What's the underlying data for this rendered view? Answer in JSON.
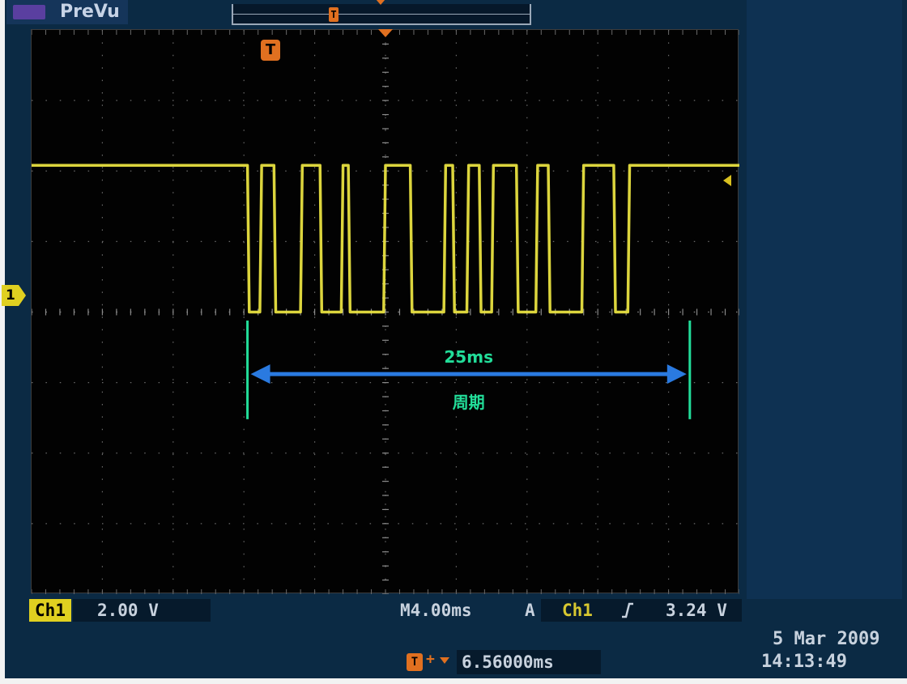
{
  "mode": {
    "label": "PreVu"
  },
  "record": {
    "trigger_marker": "T"
  },
  "annotation": {
    "period_value": "25ms",
    "period_label": "周期",
    "color": "#22dd99"
  },
  "channel": {
    "marker": "1",
    "badge": "Ch1",
    "volts_per_div": "2.00 V",
    "color": "#e8e040"
  },
  "timebase": {
    "value": "M4.00ms"
  },
  "trigger": {
    "mode": "A",
    "source": "Ch1",
    "slope_icon": "rising-edge-icon",
    "level": "3.24 V",
    "marker": "T"
  },
  "trigger_position": {
    "value": "6.56000ms"
  },
  "datetime": {
    "date": "5 Mar  2009",
    "time": "14:13:49"
  },
  "chart_data": {
    "type": "line",
    "series": [
      {
        "comment_unit": "time in ms from left edge of screen (10 div x 4 ms), volts",
        "x": [
          0,
          12.2,
          12.3,
          12.9,
          13.0,
          13.7,
          13.8,
          15.2,
          15.3,
          16.3,
          16.4,
          17.5,
          17.6,
          17.9,
          18.0,
          19.9,
          20.0,
          21.4,
          21.5,
          23.3,
          23.4,
          23.8,
          23.9,
          24.6,
          24.7,
          25.3,
          25.4,
          26.0,
          26.1,
          27.4,
          27.5,
          28.5,
          28.6,
          29.2,
          29.3,
          31.1,
          31.2,
          32.9,
          33.0,
          33.7,
          33.8,
          40
        ],
        "y": [
          5.2,
          5.2,
          0,
          0,
          5.2,
          5.2,
          0,
          0,
          5.2,
          5.2,
          0,
          0,
          5.2,
          5.2,
          0,
          0,
          5.2,
          5.2,
          0,
          0,
          5.2,
          5.2,
          0,
          0,
          5.2,
          5.2,
          0,
          0,
          5.2,
          5.2,
          0,
          0,
          5.2,
          5.2,
          0,
          0,
          5.2,
          5.2,
          0,
          0,
          5.2,
          5.2
        ]
      }
    ],
    "xlim": [
      0,
      40
    ],
    "ylim": [
      -10,
      10
    ],
    "grid": true,
    "cursors_ms": [
      12.2,
      37.2
    ],
    "period_arrow_ms": [
      12.2,
      37.2
    ]
  }
}
